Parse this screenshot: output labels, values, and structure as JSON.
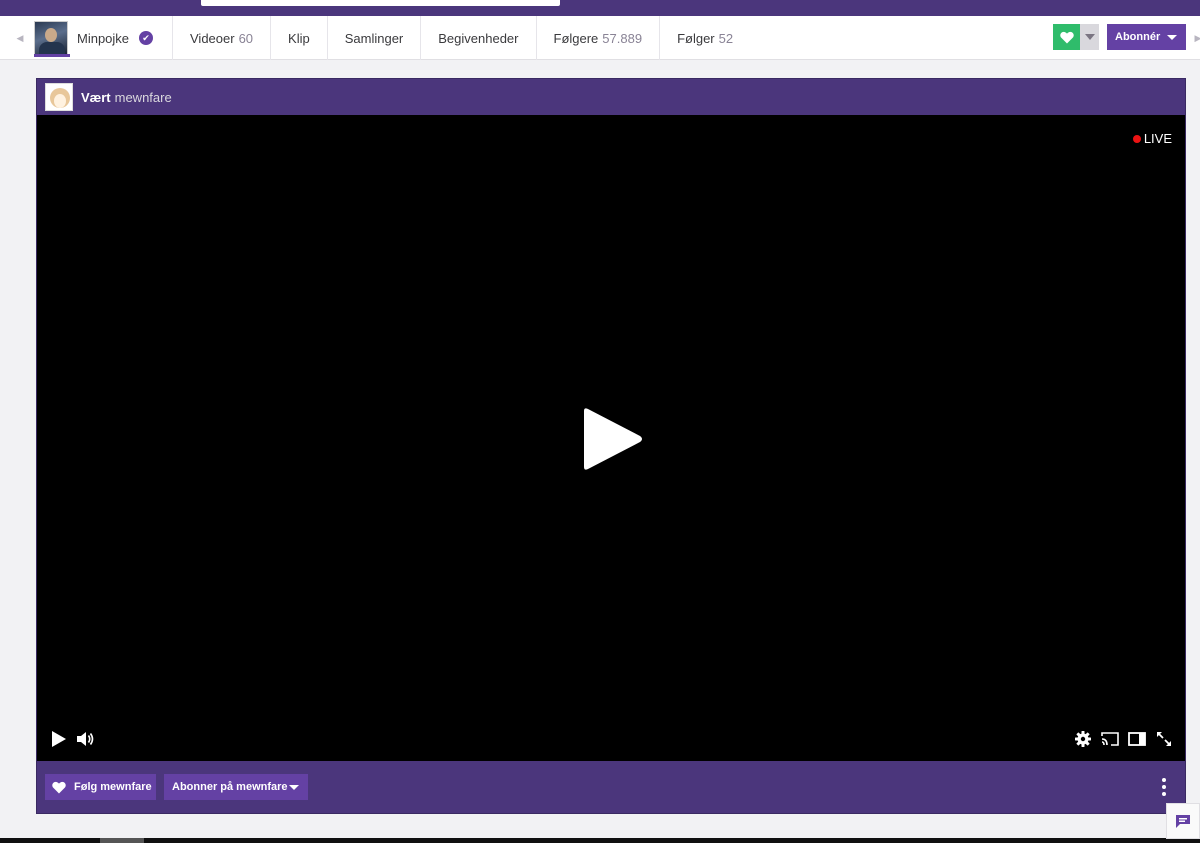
{
  "colors": {
    "brand_purple": "#6441a4",
    "panel_purple": "#4b367c",
    "follow_green": "#2fbc6b",
    "live_red": "#ec1313"
  },
  "channel_nav": {
    "left_arrow_icon": "chevron-left-icon",
    "right_arrow_icon": "chevron-right-icon",
    "profile": {
      "name": "Minpojke",
      "verified_icon": "verified-badge-icon"
    },
    "tabs": [
      {
        "label": "Videoer",
        "count": "60"
      },
      {
        "label": "Klip",
        "count": ""
      },
      {
        "label": "Samlinger",
        "count": ""
      },
      {
        "label": "Begivenheder",
        "count": ""
      },
      {
        "label": "Følgere",
        "count": "57.889"
      },
      {
        "label": "Følger",
        "count": "52"
      }
    ],
    "follow_icon": "heart-icon",
    "follow_dropdown_icon": "caret-down-icon",
    "subscribe_label": "Abonnér"
  },
  "host_bar": {
    "label": "Vært",
    "host_name": "mewnfare"
  },
  "player": {
    "live_label": "LIVE",
    "big_play_icon": "play-icon",
    "controls_left": [
      "play-icon",
      "volume-icon"
    ],
    "controls_right": [
      "settings-gear-icon",
      "cast-icon",
      "theatre-mode-icon",
      "fullscreen-icon"
    ]
  },
  "action_bar": {
    "follow_label": "Følg mewnfare",
    "subscribe_label": "Abonner på mewnfare",
    "more_icon": "more-vertical-icon"
  },
  "chat_toggle_icon": "chat-bubble-icon"
}
